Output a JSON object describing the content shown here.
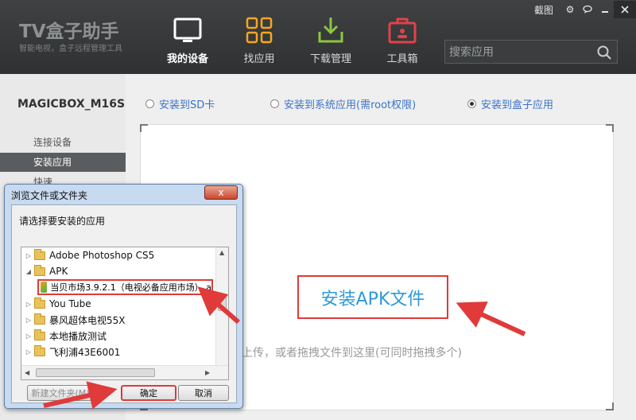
{
  "app": {
    "logo": "TV盒子助手",
    "logo_sub": "智能电视，盒子远程管理工具",
    "screenshot_label": "截图"
  },
  "nav": [
    {
      "label": "我的设备",
      "icon": "tablet-icon",
      "active": true
    },
    {
      "label": "找应用",
      "icon": "grid-icon",
      "active": false
    },
    {
      "label": "下载管理",
      "icon": "download-icon",
      "active": false
    },
    {
      "label": "工具箱",
      "icon": "toolbox-icon",
      "active": false
    }
  ],
  "search": {
    "placeholder": "搜索应用"
  },
  "sidebar": {
    "device_name": "MAGICBOX_M16S",
    "items": [
      {
        "label": "连接设备"
      },
      {
        "label": "安装应用",
        "active": true
      },
      {
        "label": "快速..."
      }
    ]
  },
  "install_options": {
    "sd_card": "安装到SD卡",
    "system": "安装到系统应用(需root权限)",
    "box": "安装到盒子应用",
    "selected": "box"
  },
  "drop_area": {
    "button": "安装APK文件",
    "hint": "击上传，或者拖拽文件到这里(可同时拖拽多个)"
  },
  "dialog": {
    "title": "浏览文件或文件夹",
    "close": "x",
    "prompt": "请选择要安装的应用",
    "tree": [
      {
        "label": "Adobe Photoshop CS5",
        "expanded": false
      },
      {
        "label": "APK",
        "expanded": true
      },
      {
        "label": "You Tube",
        "expanded": false
      },
      {
        "label": "暴风超体电视55X",
        "expanded": false
      },
      {
        "label": "本地播放测试",
        "expanded": false
      },
      {
        "label": "飞利浦43E6001",
        "expanded": false
      }
    ],
    "selected_file": "当贝市场3.9.2.1（电视必备应用市场）.a",
    "new_folder": "新建文件夹(M)",
    "ok": "确定",
    "cancel": "取消"
  },
  "colors": {
    "accent": "#2f9ad6",
    "highlight": "#e03a3a",
    "topbar": "#353738"
  }
}
